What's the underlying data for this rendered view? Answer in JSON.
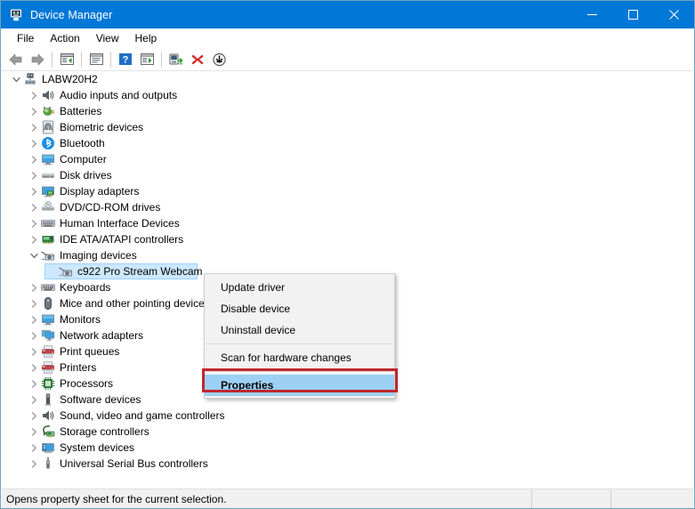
{
  "window": {
    "title": "Device Manager",
    "app_icon": "device-manager-icon",
    "accent_color": "#0078d7",
    "minimize_label": "Minimize",
    "maximize_label": "Maximize",
    "close_label": "Close"
  },
  "menubar": {
    "items": [
      {
        "label": "File",
        "name": "menu-file"
      },
      {
        "label": "Action",
        "name": "menu-action"
      },
      {
        "label": "View",
        "name": "menu-view"
      },
      {
        "label": "Help",
        "name": "menu-help"
      }
    ]
  },
  "toolbar": {
    "buttons": [
      {
        "icon": "back-arrow-icon",
        "title": "Back"
      },
      {
        "icon": "forward-arrow-icon",
        "title": "Forward"
      },
      {
        "icon": "up-one-level-icon",
        "title": "Up one level"
      },
      {
        "icon": "show-hide-console-tree-icon",
        "title": "Show/Hide Console Tree"
      },
      {
        "icon": "help-icon",
        "title": "Help"
      },
      {
        "icon": "properties-icon",
        "title": "Properties"
      },
      {
        "icon": "update-driver-icon",
        "title": "Update driver software"
      },
      {
        "icon": "uninstall-device-icon",
        "title": "Uninstall device"
      },
      {
        "icon": "scan-hardware-changes-icon",
        "title": "Scan for hardware changes"
      }
    ]
  },
  "tree": {
    "nodes": [
      {
        "label": "LABW20H2",
        "indent": 0,
        "state": "expanded",
        "icon": "computer-root-icon",
        "selected": false
      },
      {
        "label": "Audio inputs and outputs",
        "indent": 1,
        "state": "collapsed",
        "icon": "speaker-icon",
        "selected": false
      },
      {
        "label": "Batteries",
        "indent": 1,
        "state": "collapsed",
        "icon": "battery-icon",
        "selected": false
      },
      {
        "label": "Biometric devices",
        "indent": 1,
        "state": "collapsed",
        "icon": "fingerprint-icon",
        "selected": false
      },
      {
        "label": "Bluetooth",
        "indent": 1,
        "state": "collapsed",
        "icon": "bluetooth-icon",
        "selected": false
      },
      {
        "label": "Computer",
        "indent": 1,
        "state": "collapsed",
        "icon": "monitor-icon",
        "selected": false
      },
      {
        "label": "Disk drives",
        "indent": 1,
        "state": "collapsed",
        "icon": "disk-drive-icon",
        "selected": false
      },
      {
        "label": "Display adapters",
        "indent": 1,
        "state": "collapsed",
        "icon": "display-adapter-icon",
        "selected": false
      },
      {
        "label": "DVD/CD-ROM drives",
        "indent": 1,
        "state": "collapsed",
        "icon": "optical-drive-icon",
        "selected": false
      },
      {
        "label": "Human Interface Devices",
        "indent": 1,
        "state": "collapsed",
        "icon": "hid-icon",
        "selected": false
      },
      {
        "label": "IDE ATA/ATAPI controllers",
        "indent": 1,
        "state": "collapsed",
        "icon": "ide-controller-icon",
        "selected": false
      },
      {
        "label": "Imaging devices",
        "indent": 1,
        "state": "expanded",
        "icon": "camera-icon",
        "selected": false
      },
      {
        "label": "c922 Pro Stream Webcam",
        "indent": 2,
        "state": "leaf",
        "icon": "camera-icon",
        "selected": true
      },
      {
        "label": "Keyboards",
        "indent": 1,
        "state": "collapsed",
        "icon": "keyboard-icon",
        "selected": false
      },
      {
        "label": "Mice and other pointing devices",
        "indent": 1,
        "state": "collapsed",
        "icon": "mouse-icon",
        "selected": false
      },
      {
        "label": "Monitors",
        "indent": 1,
        "state": "collapsed",
        "icon": "monitor-icon",
        "selected": false
      },
      {
        "label": "Network adapters",
        "indent": 1,
        "state": "collapsed",
        "icon": "network-adapter-icon",
        "selected": false
      },
      {
        "label": "Print queues",
        "indent": 1,
        "state": "collapsed",
        "icon": "printer-icon",
        "selected": false
      },
      {
        "label": "Printers",
        "indent": 1,
        "state": "collapsed",
        "icon": "printer-icon",
        "selected": false
      },
      {
        "label": "Processors",
        "indent": 1,
        "state": "collapsed",
        "icon": "processor-icon",
        "selected": false
      },
      {
        "label": "Software devices",
        "indent": 1,
        "state": "collapsed",
        "icon": "software-device-icon",
        "selected": false
      },
      {
        "label": "Sound, video and game controllers",
        "indent": 1,
        "state": "collapsed",
        "icon": "speaker-icon",
        "selected": false
      },
      {
        "label": "Storage controllers",
        "indent": 1,
        "state": "collapsed",
        "icon": "storage-controller-icon",
        "selected": false
      },
      {
        "label": "System devices",
        "indent": 1,
        "state": "collapsed",
        "icon": "system-device-icon",
        "selected": false
      },
      {
        "label": "Universal Serial Bus controllers",
        "indent": 1,
        "state": "collapsed",
        "icon": "usb-icon",
        "selected": false
      }
    ]
  },
  "context_menu": {
    "items": [
      {
        "label": "Update driver",
        "name": "ctx-update-driver",
        "highlighted": false
      },
      {
        "label": "Disable device",
        "name": "ctx-disable-device",
        "highlighted": false
      },
      {
        "label": "Uninstall device",
        "name": "ctx-uninstall-device",
        "highlighted": false
      },
      {
        "label": "Scan for hardware changes",
        "name": "ctx-scan-hardware-changes",
        "highlighted": false
      },
      {
        "label": "Properties",
        "name": "ctx-properties",
        "highlighted": true
      }
    ],
    "highlight_color": "#9cd0f5",
    "annotation_box_color": "#c0272d"
  },
  "statusbar": {
    "message": "Opens property sheet for the current selection."
  }
}
